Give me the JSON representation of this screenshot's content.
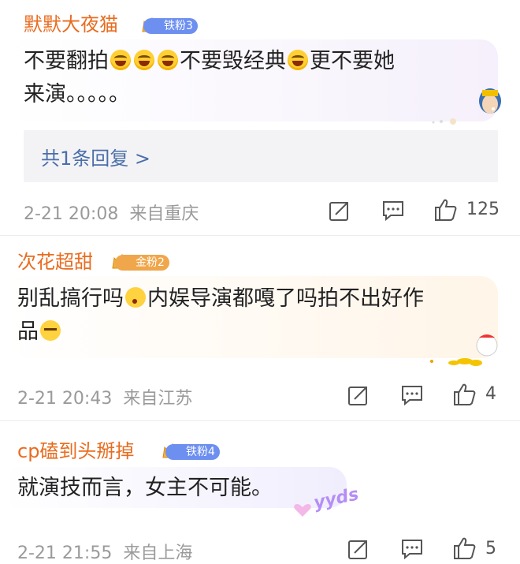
{
  "comments": [
    {
      "username": "默默大夜猫",
      "badge": "铁粉3",
      "text_line1_parts": [
        "不要翻拍",
        "不要毁经典",
        "更不要她"
      ],
      "text_line2": "来演。。。。。",
      "reply_link": "共1条回复 >",
      "time": "2-21 20:08",
      "location": "来自重庆",
      "likes": "125"
    },
    {
      "username": "次花超甜",
      "badge": "金粉2",
      "text_line1_parts": [
        "别乱搞行吗",
        "内娱导演都嘎了吗拍不出好作"
      ],
      "text_line2": "品",
      "time": "2-21 20:43",
      "location": "来自江苏",
      "likes": "4"
    },
    {
      "username": "cp磕到头掰掉",
      "badge": "铁粉4",
      "text": "就演技而言，女主不可能。",
      "sticker_text": "yyds",
      "time": "2-21 21:55",
      "location": "来自上海",
      "likes": "5"
    }
  ],
  "icons": {
    "crown": "crown-icon",
    "share": "share-icon",
    "comment": "comment-icon",
    "like": "thumbs-up-icon",
    "emoji_laugh": "laugh-cry-emoji",
    "emoji_think": "thinking-emoji",
    "emoji_wave": "facepalm-emoji"
  },
  "colors": {
    "username": "#e86c1f",
    "badge_iron": "#6c8ff0",
    "badge_gold": "#f0a64a",
    "reply_link": "#4a6fa8"
  }
}
